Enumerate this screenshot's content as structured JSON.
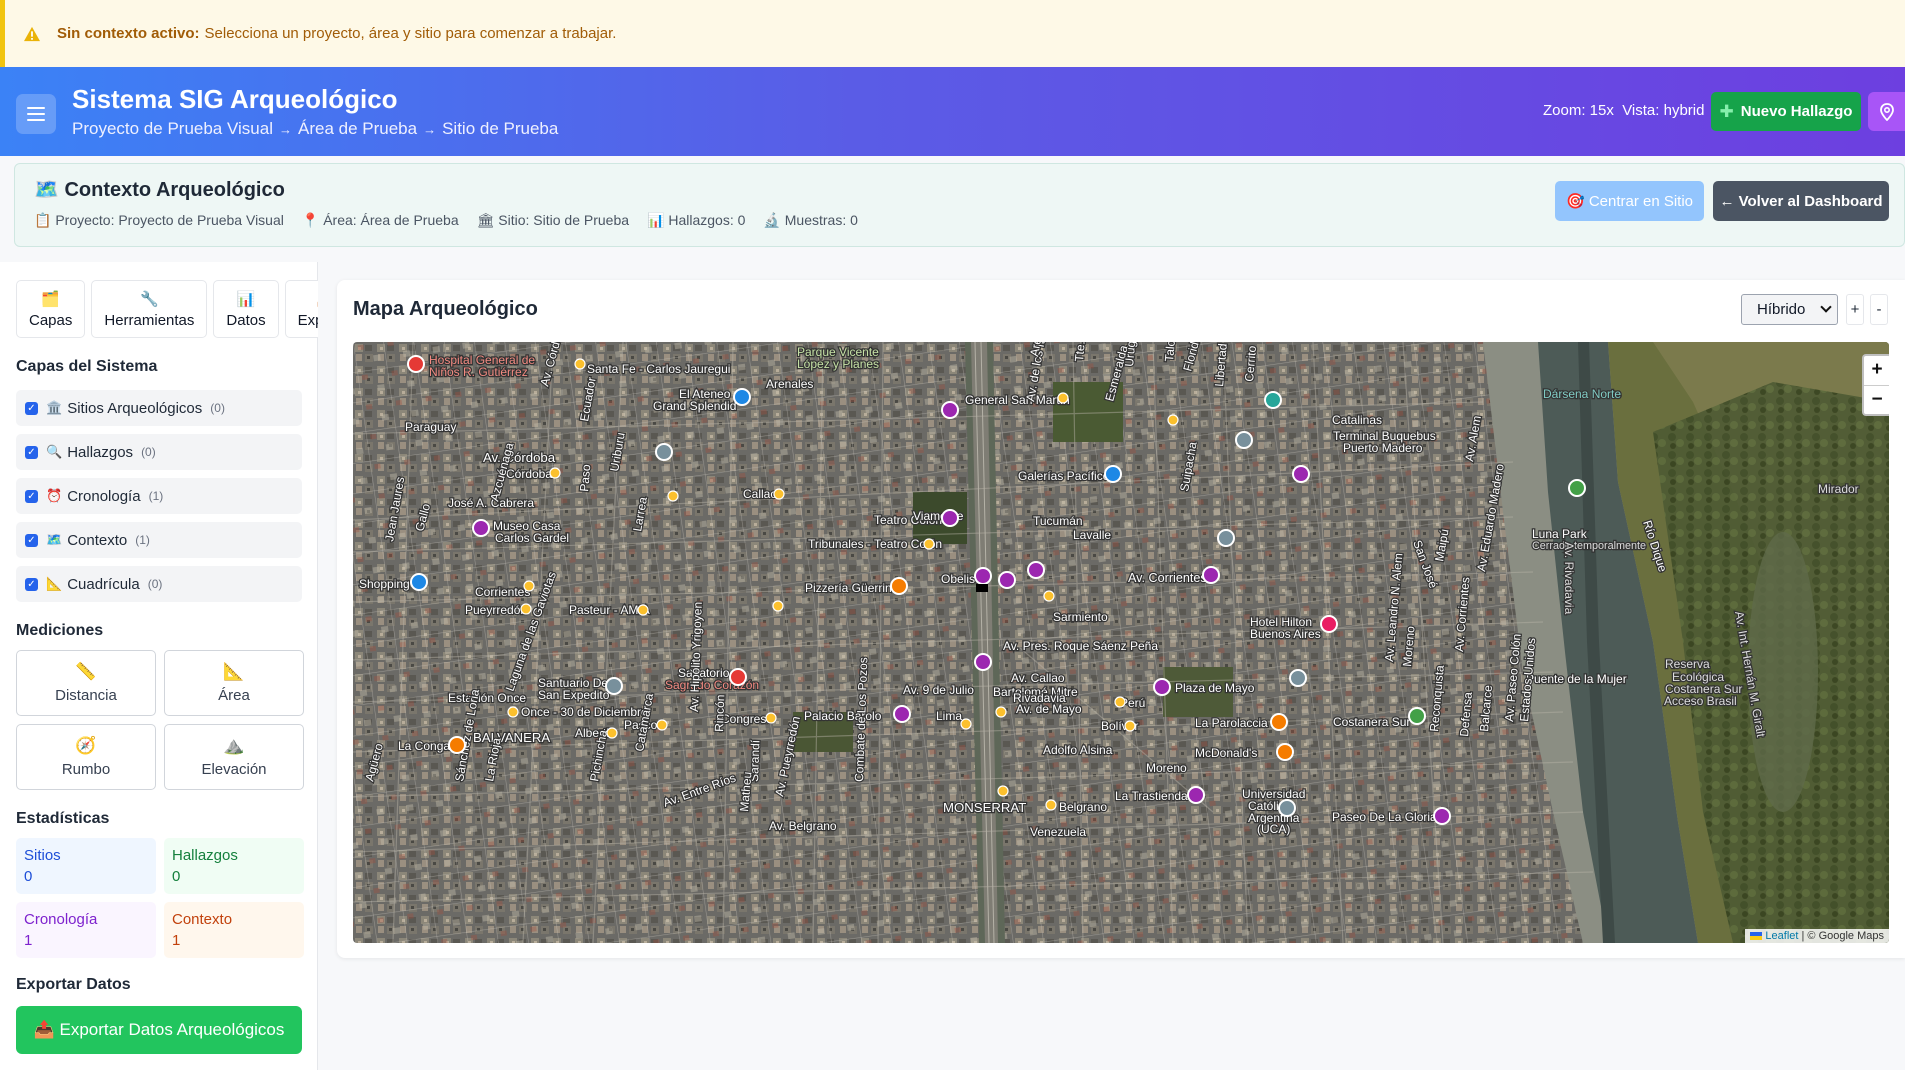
{
  "alert": {
    "title": "Sin contexto activo:",
    "message": "Selecciona un proyecto, área y sitio para comenzar a trabajar."
  },
  "header": {
    "title": "Sistema SIG Arqueológico",
    "breadcrumb": [
      "Proyecto de Prueba Visual",
      "Área de Prueba",
      "Sitio de Prueba"
    ],
    "breadcrumb_sep": "→",
    "zoom_text": "Zoom: 15x  Vista: hybrid",
    "new_finding_label": "Nuevo Hallazgo"
  },
  "context": {
    "title": "Contexto Arqueológico",
    "title_icon": "🗺️",
    "project": "📋 Proyecto: Proyecto de Prueba Visual",
    "area": "📍 Área: Área de Prueba",
    "site": "🏛 Sitio: Sitio de Prueba",
    "findings": "📊 Hallazgos: 0",
    "samples": "🔬 Muestras: 0",
    "center_button": "🎯 Centrar en Sitio",
    "back_button": "← Volver al Dashboard"
  },
  "sidebar": {
    "tabs": [
      {
        "icon": "🗂️",
        "label": "Capas"
      },
      {
        "icon": "🔧",
        "label": "Herramientas"
      },
      {
        "icon": "📊",
        "label": "Datos"
      },
      {
        "icon": "📤",
        "label": "Exportar"
      }
    ],
    "layers_title": "Capas del Sistema",
    "layers": [
      {
        "icon": "🏛️",
        "label": "Sitios Arqueológicos",
        "count": "(0)"
      },
      {
        "icon": "🔍",
        "label": "Hallazgos",
        "count": "(0)"
      },
      {
        "icon": "⏰",
        "label": "Cronología",
        "count": "(1)"
      },
      {
        "icon": "🗺️",
        "label": "Contexto",
        "count": "(1)"
      },
      {
        "icon": "📐",
        "label": "Cuadrícula",
        "count": "(0)"
      }
    ],
    "measure_title": "Mediciones",
    "measures": [
      {
        "icon": "📏",
        "label": "Distancia"
      },
      {
        "icon": "📐",
        "label": "Área"
      },
      {
        "icon": "🧭",
        "label": "Rumbo"
      },
      {
        "icon": "⛰️",
        "label": "Elevación"
      }
    ],
    "stats_title": "Estadísticas",
    "stats": [
      {
        "label": "Sitios",
        "value": "0",
        "bg": "#eff6ff",
        "color": "#1d4ed8"
      },
      {
        "label": "Hallazgos",
        "value": "0",
        "bg": "#f0fdf4",
        "color": "#15803d"
      },
      {
        "label": "Cronología",
        "value": "1",
        "bg": "#faf5ff",
        "color": "#7e22ce"
      },
      {
        "label": "Contexto",
        "value": "1",
        "bg": "#fff7ed",
        "color": "#c2410c"
      }
    ],
    "export_title": "Exportar Datos",
    "export_button": "📤 Exportar Datos Arqueológicos"
  },
  "map": {
    "title": "Mapa Arqueológico",
    "view_select": "Híbrido",
    "zoom_in": "+",
    "zoom_out": "-",
    "leaflet_zoom_in": "+",
    "leaflet_zoom_out": "−",
    "attribution_link": "Leaflet",
    "attribution_rest": "| © Google Maps",
    "labels": [
      "Hospital General de",
      "Niños R. Gutiérrez",
      "Santa Fe - Carlos Jauregui",
      "El Ateneo",
      "Grand Splendid",
      "Arenales",
      "Parque Vicente",
      "López y Planes",
      "General San Martín",
      "Dársena Norte",
      "Catalinas",
      "Terminal Buquebus",
      "Puerto Madero",
      "Av. Córdoba",
      "Córdoba",
      "Galerías Pacífico",
      "Callao",
      "Teatro Colón",
      "Tribunales - Teatro Colón",
      "Museo Casa",
      "Carlos Gardel",
      "Luna Park",
      "Cerrado temporalmente",
      "Mirador",
      "Obelisco",
      "Pizzería Güerrin",
      "Av. Corrientes",
      "Shopping",
      "Corrientes",
      "Pueyrredón",
      "Pasteur - AMIA",
      "Sarmiento",
      "Av. Pres. Roque Sáenz Peña",
      "Hotel Hilton",
      "Buenos Aires",
      "Av. 9 de Julio",
      "Bartolomé Mitre",
      "Puente de la Mujer",
      "Sanatorio",
      "Sagrado Corazón",
      "Santuario De",
      "San Expedito",
      "Estación Once",
      "Plaza de Mayo",
      "Perú",
      "Av. de Mayo",
      "Congreso",
      "Palacio Barolo",
      "Lima",
      "Bolívar",
      "La Parolaccia",
      "Costanera Sur",
      "Reserva",
      "Ecológica",
      "Costanera Sur",
      "Acceso Brasil",
      "Once - 30 de Diciembre",
      "BALVANERA",
      "La Conga",
      "Pasco",
      "Alberti",
      "McDonald's",
      "Moreno",
      "La Trastienda",
      "Universidad",
      "Católica",
      "Argentina",
      "(UCA)",
      "Paseo De La Gloria",
      "MONSERRAT",
      "Belgrano",
      "Av. Belgrano",
      "Venezuela",
      "Adolfo Alsina",
      "Viamonte",
      "Tucumán",
      "Lavalle",
      "Paraguay",
      "José A. Cabrera",
      "Av. Callao",
      "Rivadavia",
      "Av. Rivadavia",
      "Río Dique",
      "Av. Int. Hernán M. Giralt",
      "Laguna de las Gaviotas",
      "Av. Pueyrredón",
      "Av. Entre Ríos",
      "Av. Hipólito Yrigoyen",
      "Rincón",
      "Sarandí",
      "Combate de Los Pozos",
      "San José",
      "Av. de los Italianos",
      "Arenales",
      "Esmeralda",
      "Florida",
      "Suipacha",
      "Maipú",
      "Av. Eduardo Madero",
      "Av. Alem",
      "Av. Córdoba",
      "Ecuador",
      "Larrea",
      "Paso",
      "Uriburu",
      "Azcuénaga",
      "Jean Jaures",
      "Gallo",
      "Agüero",
      "Sánchez de Loria",
      "La Rioja",
      "Catamarca",
      "Pichincha",
      "Matheu",
      "Moreno",
      "Reconquista",
      "Defensa",
      "Balcarce",
      "Av. Paseo Colón",
      "Estados Unidos",
      "Av. Leandro N. Alem",
      "Av. Corrientes",
      "Tte. Gral. Juan D. Perón",
      "Uruguay",
      "Talcahuano",
      "Libertad",
      "Cerrito",
      "Carlos Pellegrini",
      "Bernardo de Irigoyen"
    ]
  }
}
